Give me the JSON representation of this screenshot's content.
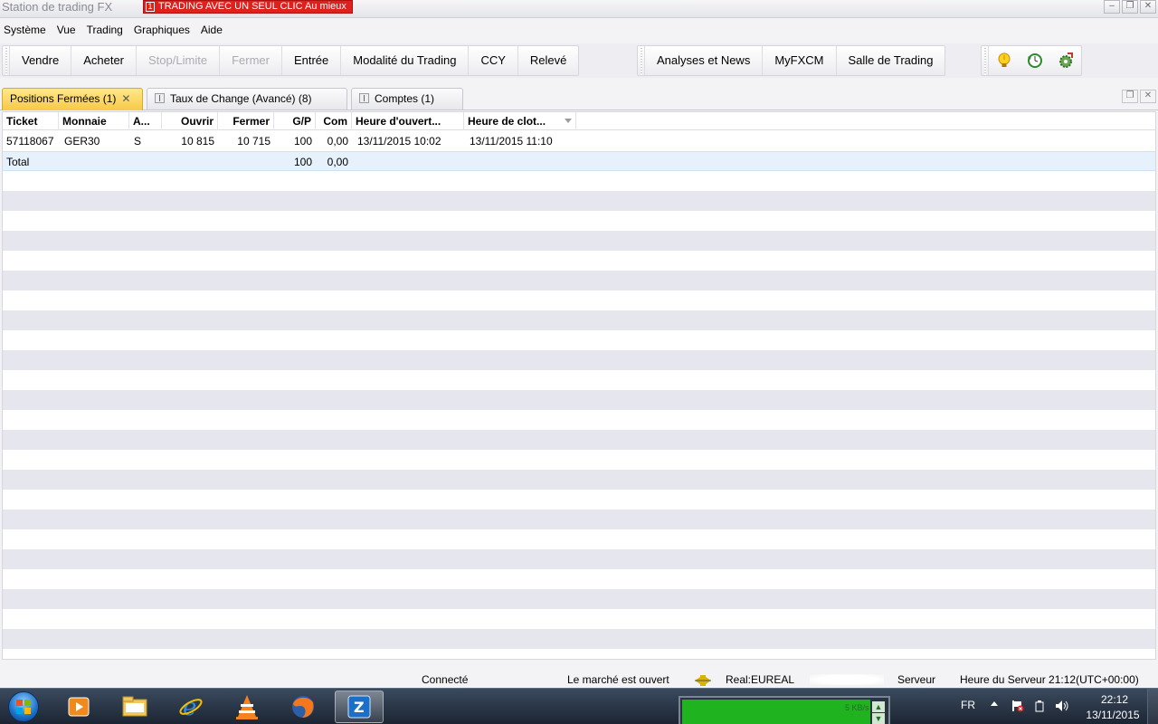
{
  "window": {
    "title": "Station de trading FX",
    "oneclick_number": "1",
    "oneclick_label": "TRADING AVEC UN SEUL CLIC Au mieux"
  },
  "menu": [
    "Système",
    "Vue",
    "Trading",
    "Graphiques",
    "Aide"
  ],
  "toolbar": {
    "group1": [
      {
        "label": "Vendre",
        "enabled": true
      },
      {
        "label": "Acheter",
        "enabled": true
      },
      {
        "label": "Stop/Limite",
        "enabled": false
      },
      {
        "label": "Fermer",
        "enabled": false
      },
      {
        "label": "Entrée",
        "enabled": true
      },
      {
        "label": "Modalité du Trading",
        "enabled": true
      },
      {
        "label": "CCY",
        "enabled": true
      },
      {
        "label": "Relevé",
        "enabled": true
      }
    ],
    "group2": [
      "Analyses et News",
      "MyFXCM",
      "Salle de Trading"
    ],
    "icons": [
      "lightbulb-icon",
      "clock-refresh-icon",
      "gear-settings-icon"
    ]
  },
  "tabs": [
    {
      "label": "Positions Fermées (1)",
      "active": true
    },
    {
      "label": "Taux de Change (Avancé) (8)",
      "active": false
    },
    {
      "label": "Comptes (1)",
      "active": false
    }
  ],
  "table": {
    "columns": [
      "Ticket",
      "Monnaie",
      "A...",
      "Ouvrir",
      "Fermer",
      "G/P",
      "Com",
      "Heure d'ouvert...",
      "Heure de clot..."
    ],
    "rows": [
      [
        "57118067",
        "GER30",
        "S",
        "10 815",
        "10 715",
        "100",
        "0,00",
        "13/11/2015 10:02",
        "13/11/2015 11:10"
      ]
    ],
    "total": {
      "label": "Total",
      "gp": "100",
      "com": "0,00"
    }
  },
  "status": {
    "connection": "Connecté",
    "market": "Le marché est ouvert",
    "account": "Real:EUREAL",
    "server_label": "Serveur",
    "server_time": "Heure du Serveur 21:12(UTC+00:00)"
  },
  "taskbar": {
    "net_speed": "5 KB/s",
    "lang": "FR",
    "time": "22:12",
    "date": "13/11/2015",
    "colors": {
      "net_graph": "#1fb31f",
      "oneclick": "#e0201c",
      "active_tab": "#f7c948"
    }
  }
}
